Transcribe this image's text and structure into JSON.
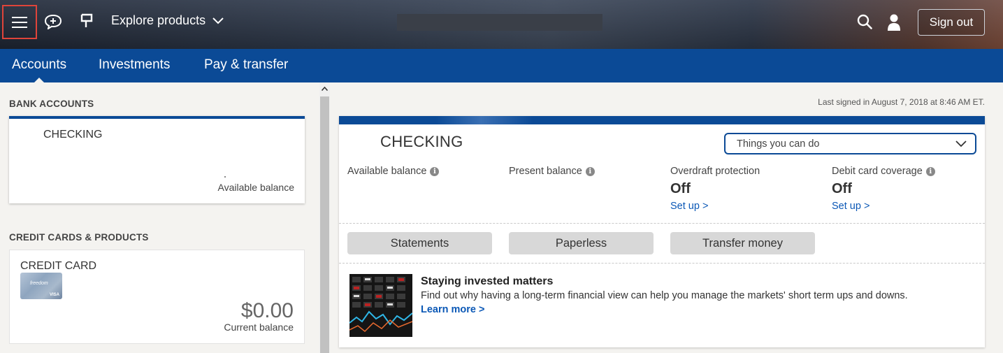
{
  "header": {
    "explore_label": "Explore products",
    "signout_label": "Sign out"
  },
  "nav": {
    "tabs": [
      {
        "label": "Accounts",
        "active": true
      },
      {
        "label": "Investments",
        "active": false
      },
      {
        "label": "Pay & transfer",
        "active": false
      }
    ]
  },
  "sidebar": {
    "bank_section_label": "BANK ACCOUNTS",
    "bank_account": {
      "name": "CHECKING",
      "balance_label": "Available balance"
    },
    "credit_section_label": "CREDIT CARDS & PRODUCTS",
    "credit_card": {
      "name": "CREDIT CARD",
      "image_brand": "VISA",
      "image_text": "freedom",
      "amount": "$0.00",
      "balance_label": "Current balance"
    }
  },
  "main": {
    "last_signed": "Last signed in August 7, 2018 at 8:46 AM ET.",
    "account_title": "CHECKING",
    "things_dropdown": "Things you can do",
    "metrics": [
      {
        "label": "Available balance",
        "value": "",
        "info": true
      },
      {
        "label": "Present balance",
        "value": "",
        "info": true
      },
      {
        "label": "Overdraft protection",
        "value": "Off",
        "link": "Set up >",
        "info": false
      },
      {
        "label": "Debit card coverage",
        "value": "Off",
        "link": "Set up >",
        "info": true
      }
    ],
    "actions": [
      "Statements",
      "Paperless",
      "Transfer money"
    ],
    "promo": {
      "title": "Staying invested matters",
      "text": "Find out why having a long-term financial view can help you manage the markets' short term ups and downs.",
      "link": "Learn more  >"
    }
  },
  "colors": {
    "nav_blue": "#0b4a96",
    "link_blue": "#0b58b6",
    "highlight_red": "#e0443a"
  }
}
